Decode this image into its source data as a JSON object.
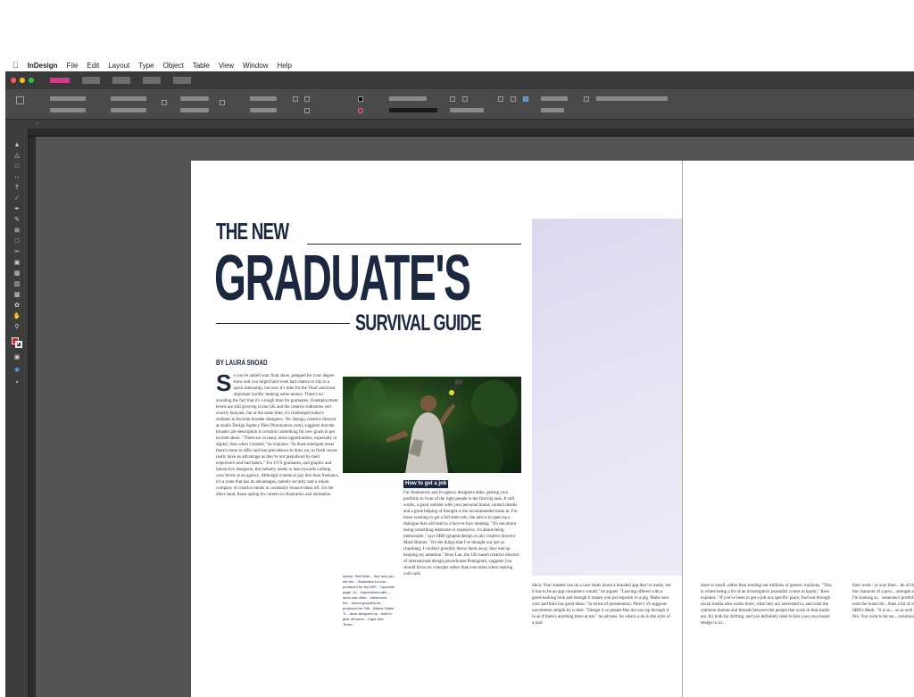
{
  "menu": {
    "app_name": "InDesign",
    "items": [
      "File",
      "Edit",
      "Layout",
      "Type",
      "Object",
      "Table",
      "View",
      "Window",
      "Help"
    ]
  },
  "colors": {
    "heading": "#1c2740",
    "window_bg": "#535353",
    "accent_swatch": "#d23c8a"
  },
  "article": {
    "title_line1": "THE NEW",
    "title_line2": "GRADUATE'S",
    "title_line3": "SURVIVAL GUIDE",
    "byline": "BY LAURA SNOAD",
    "dropcap": "S",
    "col1": "o you've nailed your final show, prepped for your degree show and you might have even had chance to slip in a quick internship, but now it's time for the 'final' and most important hurdle: making some money. There's no avoiding the fact that it's a tough time for graduates. Unemployment levels are still growing in the UK and the creative industries isn't exactly buoyant, but at the same time, it's challenged today's students to become broader designers. Nic Ikenga, creative director at studio Design Agency Pale (Nominative.com), suggests that the broader job description is certainly something for new grads to get excited about. \"There are so many more opportunities, especially in digital, than when I started,\" he explains. \"In these emergent areas there's more to offer and less precedence to draw on, so fresh voices really have an advantage as they're not prejudiced by their experience and bad habits.\" For UVS graduates, and graphic and interactive designers, the industry needs to lean towards curbing your levels at an agency. Although it tends to pay less than freelance, it's a route that has its advantages, namely security and a whole company of creative minds in constantly bounce ideas off. On the other hand, those opting for careers in illustration and animation",
    "col2_subhead": "How to get a job",
    "col2": "For freelancers and in-agency designers alike, getting your portfolio in front of the right people is the first big task. It still works, a good website with your personal brand, contact details and a great helping of thought is the recommended route in. For those wanting to get a full-time role, the aim is to open up a dialogue that will lead to a face-to-face meeting. \"It's not about doing something elaborate or expensive, it's about being memorable,\" says SBH (graphicdesign.co.uk) creative director Mark Bonner. \"It's the things that I've thought out just as charming; I couldn't possibly throw them away, they end up keeping my attention.\" Ross Lan, the UK-based creative director of international design powerhouse Pentagram, suggests you should focus on concepts rather than execution when making cold calls",
    "col3_sidebar": "Above: Self Defe... See how you are the... Illustration for use... produced for the ART... Opposite page: Ju... explorations with... deck and other... influenced the... mixed graphics for... produced for Offi... Below: Make Ti... deck designed by... built to give off some... Cape and Texas...",
    "col4": "ditch. Your student can do a case study about a branded app they've made, but it has to be an app consumers would,\" he argues. \"Leaving offered with a good-looking look and enough it means you put legwork to a pig. Make sure your portfolio has great ideas.\" In terms of presentation, Peter's Ve suggests uncommon simplicity is best. \"Design it so people like me can zip through it in as if there's anything there at me,\" he advises. So what's a do in the style of a post",
    "col5": "done or small, rather than sending out millions of generic mailouts. \"This is where being a bit of an investigative journalist comes in handy,\" Ross explains. \"If you've been to get a job at a specific place, find out through social media who works there, what they are interested in, and what the common themes and threads between the people that work in that studio are. It's both for drifting, and you definitely need to hire your own brand design to so...",
    "col6": "their work - or sure their... be of the time. That's sti... the character of a pers... strength as a designer. \"When I'm looking at... someone's portfolio I wo... always look the brand de... thats a bit of creative ca... says SBH's Mark. \"It is so... us as well think they've b... as fire. You want to be stu... solutions and rather than..."
  }
}
